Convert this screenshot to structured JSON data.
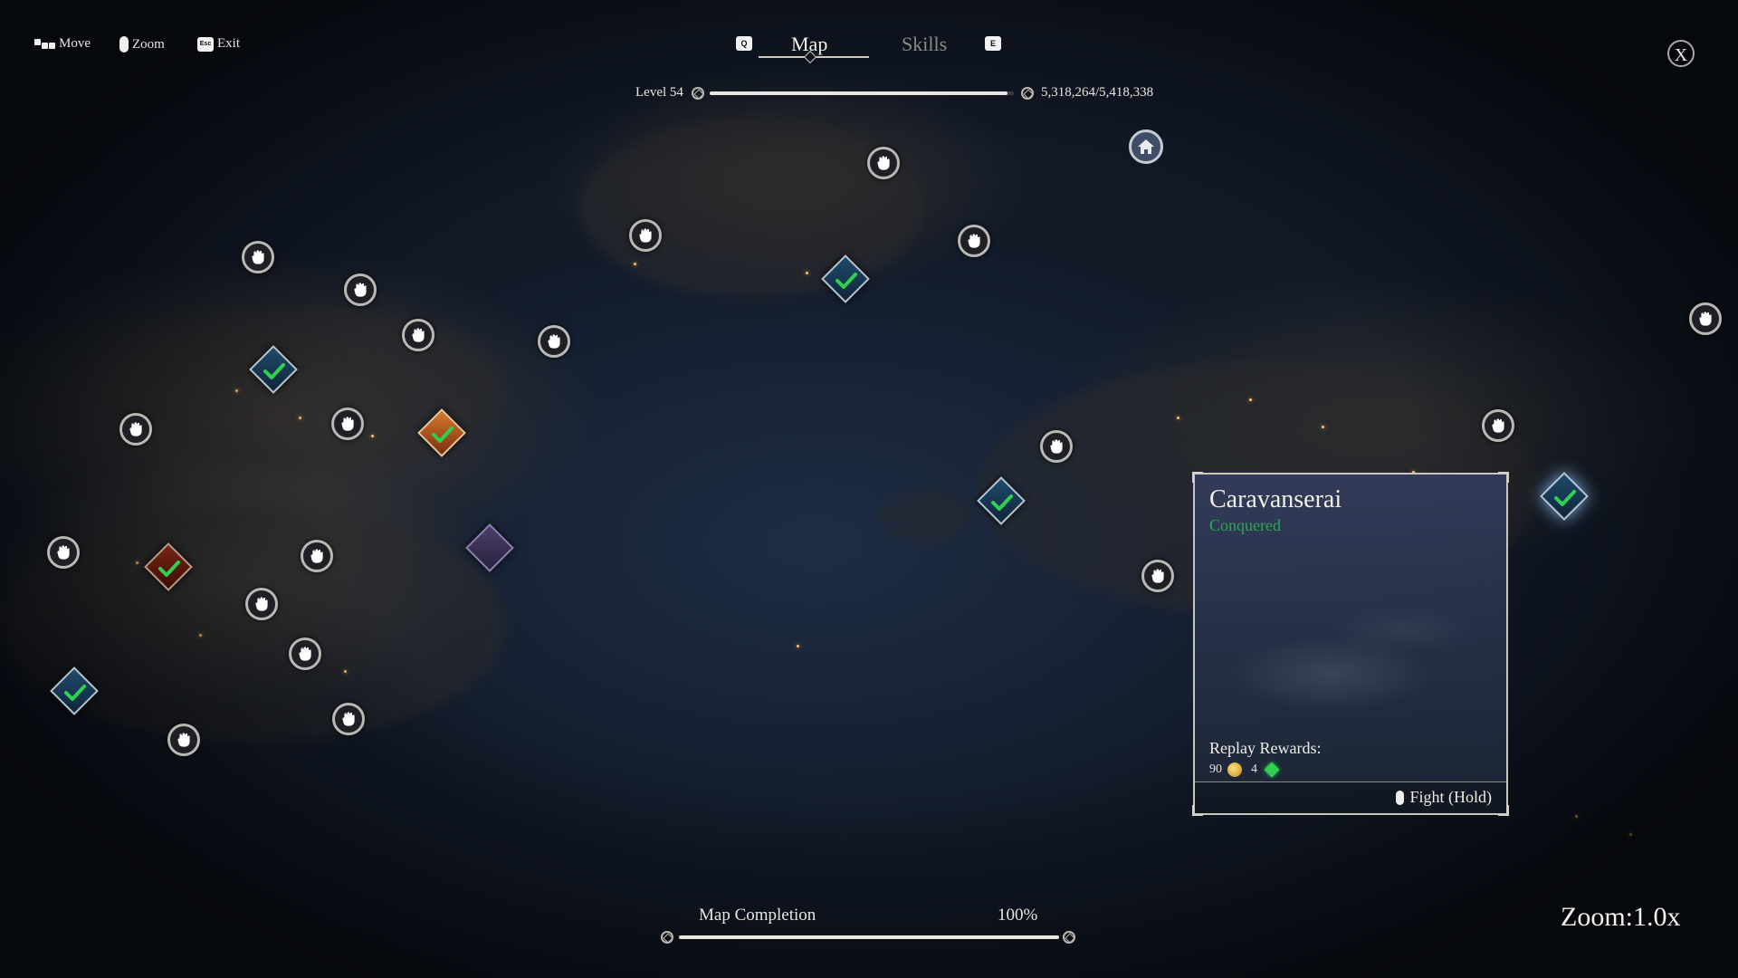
{
  "controls": {
    "move_label": "Move",
    "zoom_label": "Zoom",
    "exit_label": "Exit",
    "exit_key": "Esc"
  },
  "tabs": {
    "left_key": "Q",
    "right_key": "E",
    "map": "Map",
    "skills": "Skills",
    "active": "Map"
  },
  "close_label": "X",
  "level": {
    "label": "Level 54",
    "xp_text": "5,318,264/5,418,338",
    "progress_fraction": 0.98
  },
  "location_card": {
    "title": "Caravanserai",
    "status": "Conquered",
    "rewards_label": "Replay Rewards:",
    "gold": "90",
    "gems": "4",
    "action": "Fight (Hold)"
  },
  "completion": {
    "label": "Map Completion",
    "percent_text": "100%",
    "progress_fraction": 1.0
  },
  "zoom_text": "Zoom:1.0x",
  "colors": {
    "conquered_green": "#2fa84f",
    "marker_blue": "#1f4a6a",
    "marker_orange": "#d87a2e",
    "marker_red": "#7a2414",
    "marker_purple": "#4a3e66"
  }
}
